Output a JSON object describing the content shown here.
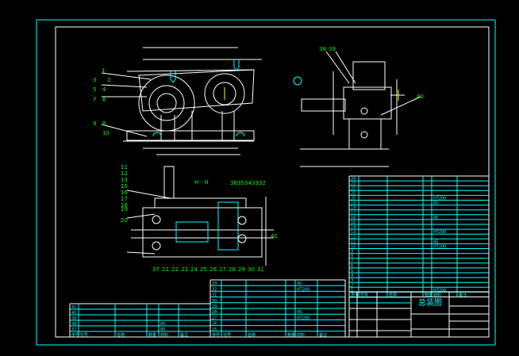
{
  "drawing": {
    "title": "总装图",
    "section_label": "H - H",
    "colors": {
      "background": "#000000",
      "frame": "#00ffff",
      "lines": "#ffffff",
      "dimensions": "#00ff00",
      "tables": "#00ffff"
    }
  },
  "front_view": {
    "balloons": [
      "1",
      "2",
      "3",
      "4",
      "5",
      "6",
      "7",
      "8",
      "9",
      "10"
    ]
  },
  "side_view": {
    "balloons": [
      "38",
      "39",
      "40"
    ]
  },
  "section_view": {
    "balloons_left": [
      "11",
      "12",
      "13",
      "15",
      "16",
      "17",
      "18",
      "19",
      "20"
    ],
    "balloons_top": [
      "36",
      "35",
      "34",
      "33",
      "32"
    ],
    "balloons_right": [
      "41"
    ],
    "balloons_bottom": [
      "37",
      "21",
      "22",
      "23",
      "24",
      "25",
      "26",
      "27",
      "28",
      "29",
      "30",
      "31"
    ]
  },
  "parts_list_right": {
    "header": [
      "序号",
      "代号",
      "名称",
      "数量",
      "材料",
      "备注"
    ],
    "rows": [
      "24",
      "23",
      "22",
      "21",
      "20",
      "19",
      "18",
      "17",
      "16",
      "15",
      "14",
      "13",
      "12",
      "11",
      "10",
      "9",
      "8",
      "7",
      "6",
      "5",
      "4",
      "3",
      "2",
      "1"
    ],
    "materials": {
      "20": "HT200",
      "13": "HT200",
      "10": "HT200",
      "1": "HT200",
      "19": "45",
      "16": "45",
      "11": "45"
    }
  },
  "parts_list_middle": {
    "header": [
      "序号",
      "代号",
      "名称",
      "数量",
      "材料",
      "备注"
    ],
    "rows": [
      "33",
      "32",
      "31",
      "30",
      "29",
      "28",
      "27",
      "26",
      "25"
    ],
    "materials": {
      "33": "45",
      "32": "HT200",
      "28": "45",
      "27": "HT200"
    }
  },
  "parts_list_left": {
    "header": [
      "序号",
      "代号",
      "名称",
      "数量",
      "材料",
      "备注"
    ],
    "rows": [
      "41",
      "40",
      "39",
      "38",
      "37"
    ],
    "materials": {
      "38": "45",
      "37": "45"
    }
  }
}
